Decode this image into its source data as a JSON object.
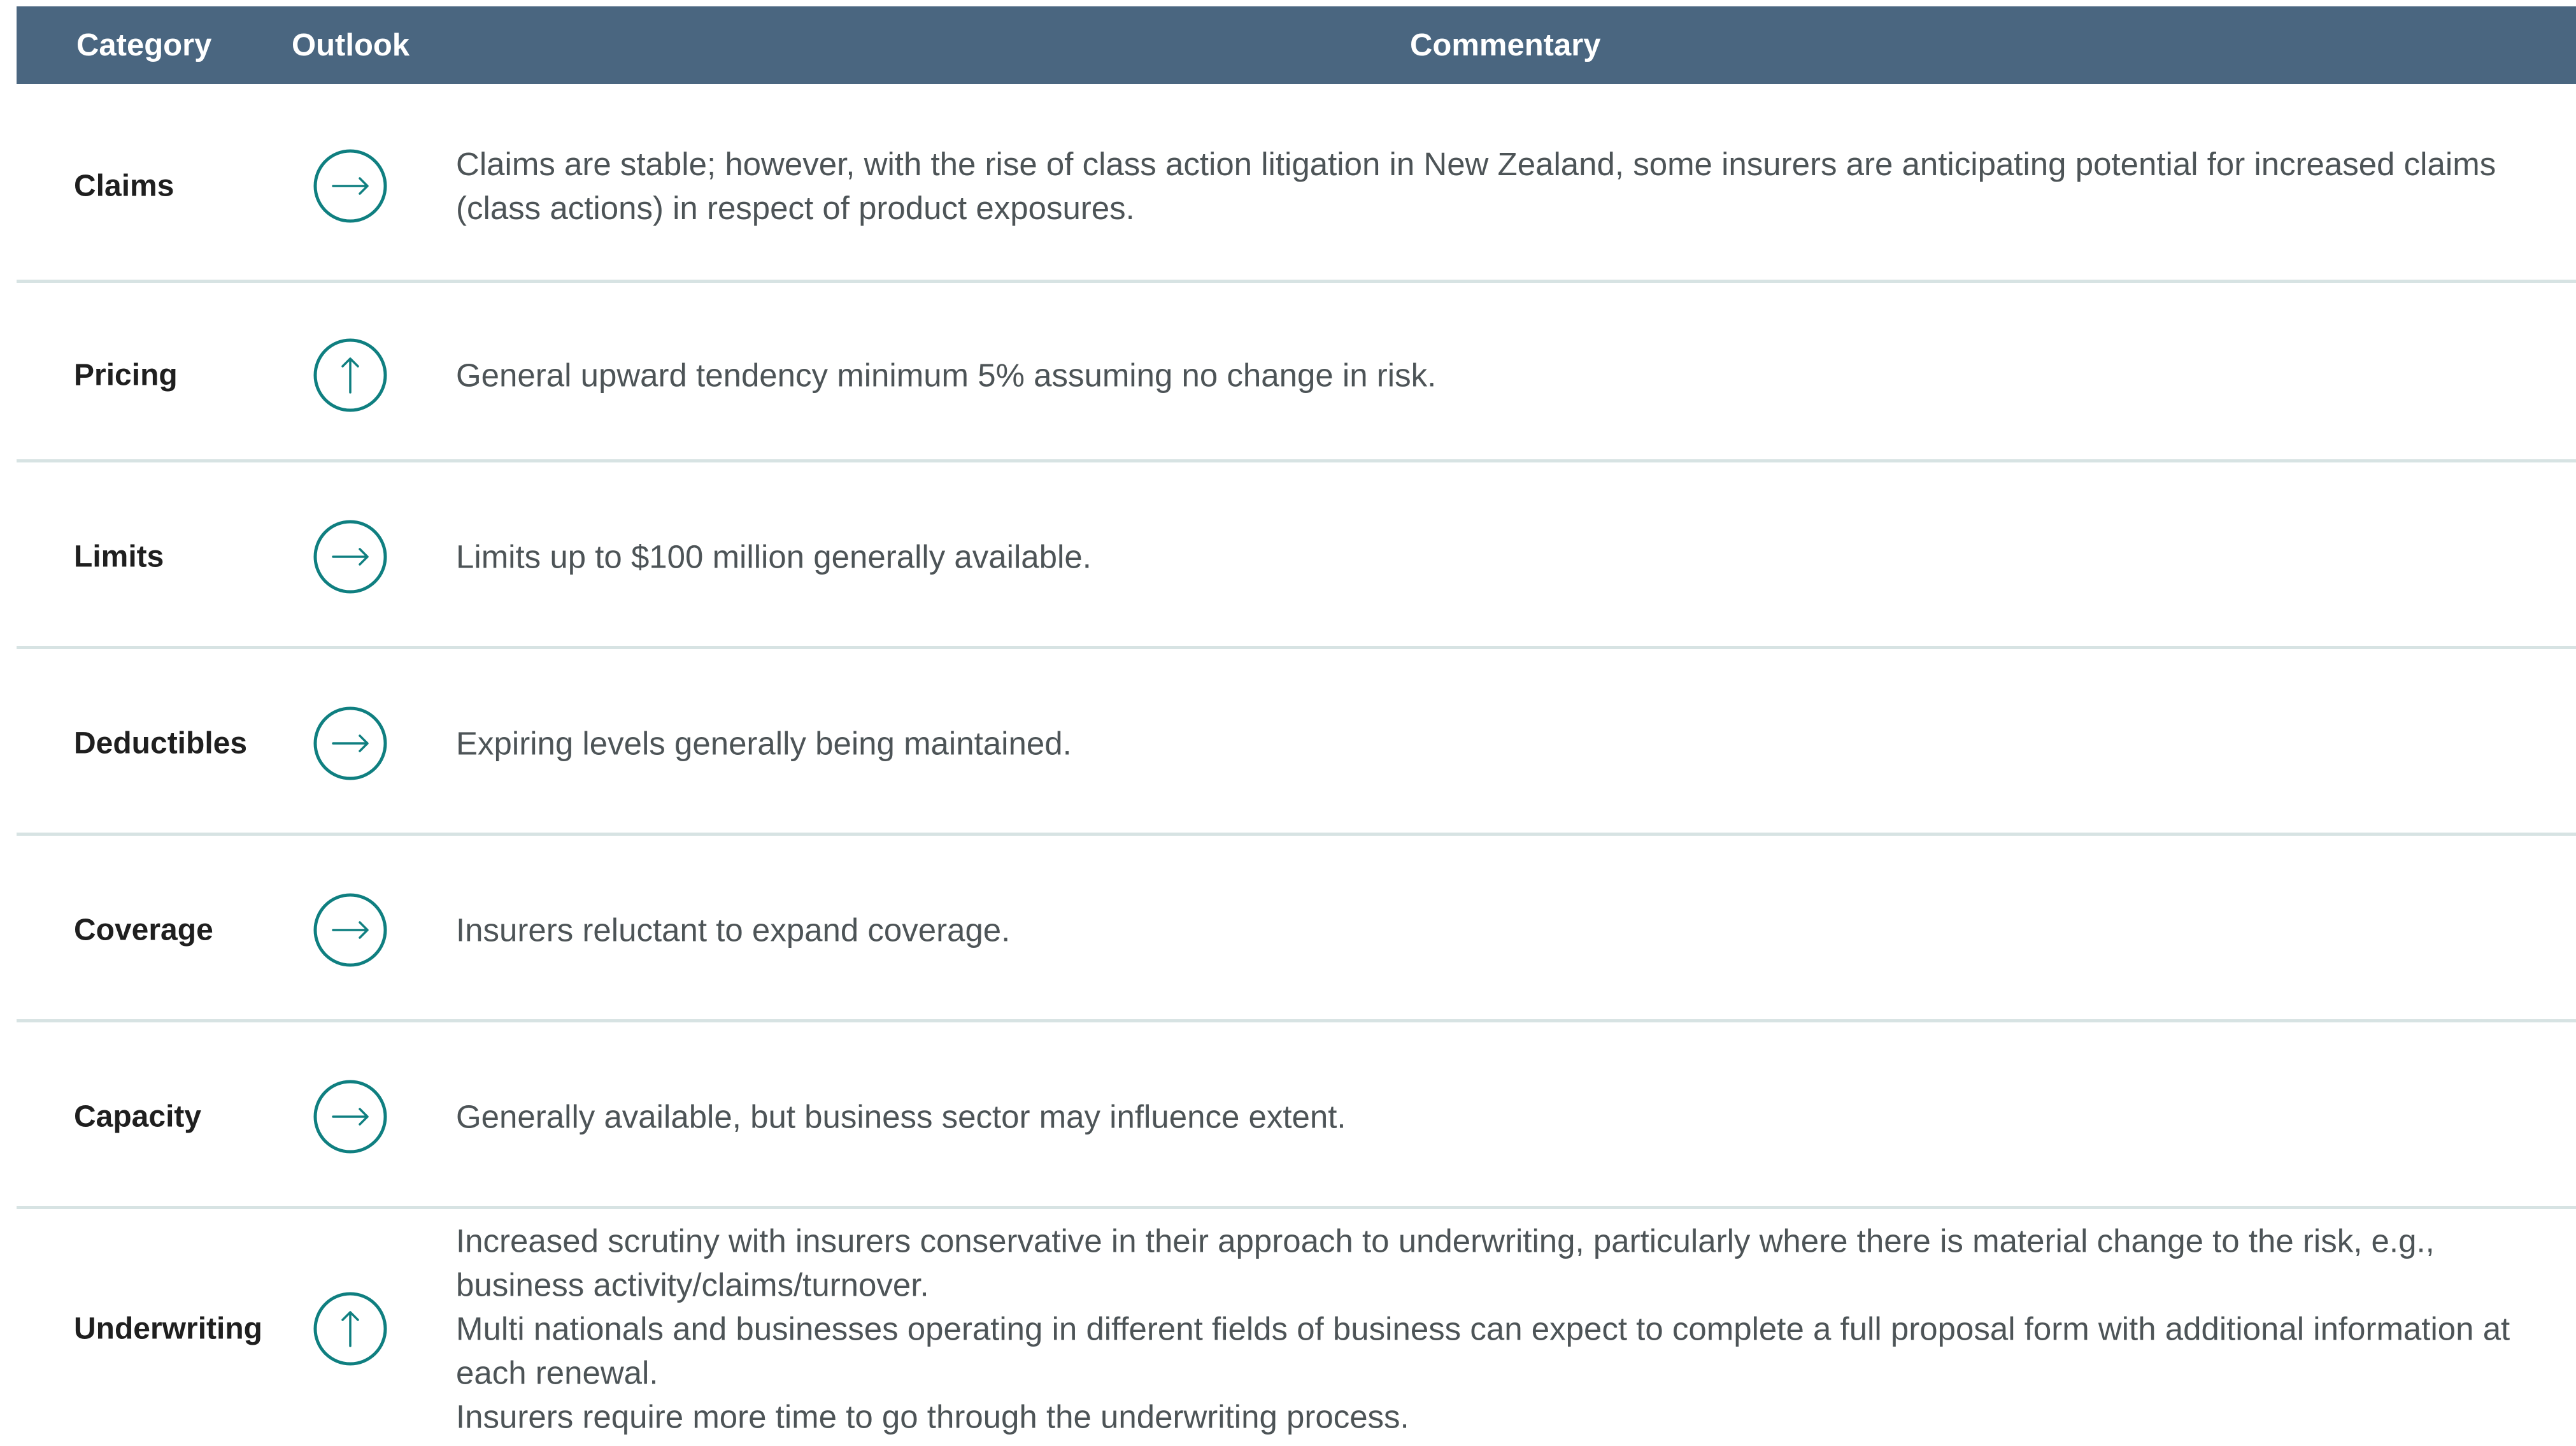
{
  "table": {
    "headers": {
      "category": "Category",
      "outlook": "Outlook",
      "commentary": "Commentary"
    },
    "colors": {
      "header_bg": "#4a6680",
      "icon": "#0f7f80",
      "divider": "#d7e3e3"
    },
    "rows": [
      {
        "category": "Claims",
        "outlook_icon": "arrow-right-circle-icon",
        "commentary": [
          "Claims are stable; however, with the rise of class action litigation in New Zealand, some insurers are anticipating potential for increased claims (class actions) in respect of product exposures."
        ]
      },
      {
        "category": "Pricing",
        "outlook_icon": "arrow-up-circle-icon",
        "commentary": [
          "General upward tendency minimum 5% assuming no change in risk."
        ]
      },
      {
        "category": "Limits",
        "outlook_icon": "arrow-right-circle-icon",
        "commentary": [
          "Limits up to $100 million generally available."
        ]
      },
      {
        "category": "Deductibles",
        "outlook_icon": "arrow-right-circle-icon",
        "commentary": [
          "Expiring levels generally being maintained."
        ]
      },
      {
        "category": "Coverage",
        "outlook_icon": "arrow-right-circle-icon",
        "commentary": [
          "Insurers reluctant to expand coverage."
        ]
      },
      {
        "category": "Capacity",
        "outlook_icon": "arrow-right-circle-icon",
        "commentary": [
          "Generally available, but business sector may influence extent."
        ]
      },
      {
        "category": "Underwriting",
        "outlook_icon": "arrow-up-circle-icon",
        "commentary": [
          "Increased scrutiny with insurers conservative in their approach to underwriting, particularly where there is material change to the risk, e.g., business activity/claims/turnover.",
          "Multi nationals and businesses operating in different fields of business can expect to complete a full proposal form with additional information at each renewal.",
          "Insurers require more time to go through the underwriting process."
        ]
      }
    ]
  }
}
